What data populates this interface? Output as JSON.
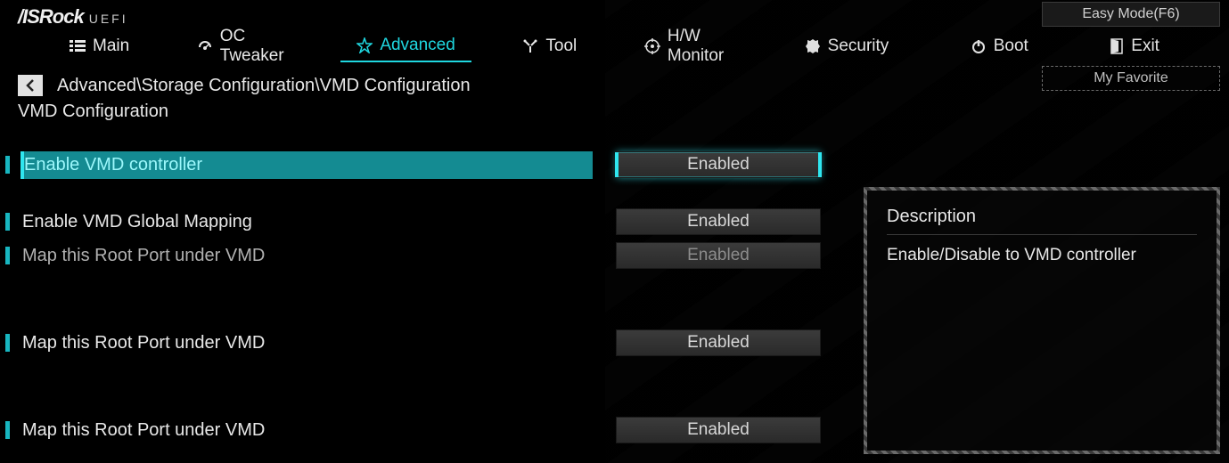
{
  "header": {
    "brand": "/ISRock",
    "brand_sub": "UEFI",
    "easy_mode": "Easy Mode(F6)",
    "my_favorite": "My Favorite"
  },
  "nav": {
    "main": "Main",
    "oc": "OC Tweaker",
    "advanced": "Advanced",
    "tool": "Tool",
    "hw": "H/W Monitor",
    "security": "Security",
    "boot": "Boot",
    "exit": "Exit"
  },
  "breadcrumb": "Advanced\\Storage Configuration\\VMD Configuration",
  "section": "VMD Configuration",
  "rows": [
    {
      "label": "Enable VMD controller",
      "value": "Enabled",
      "selected": true
    },
    {
      "label": "Enable VMD Global Mapping",
      "value": "Enabled"
    },
    {
      "label": "Map this Root Port under VMD",
      "value": "Enabled",
      "dim": true
    },
    {
      "label": "Map this Root Port under VMD",
      "value": "Enabled",
      "gap_before": true
    },
    {
      "label": "Map this Root Port under VMD",
      "value": "Enabled",
      "gap_before": true
    }
  ],
  "description": {
    "title": "Description",
    "body": "Enable/Disable to VMD controller"
  }
}
